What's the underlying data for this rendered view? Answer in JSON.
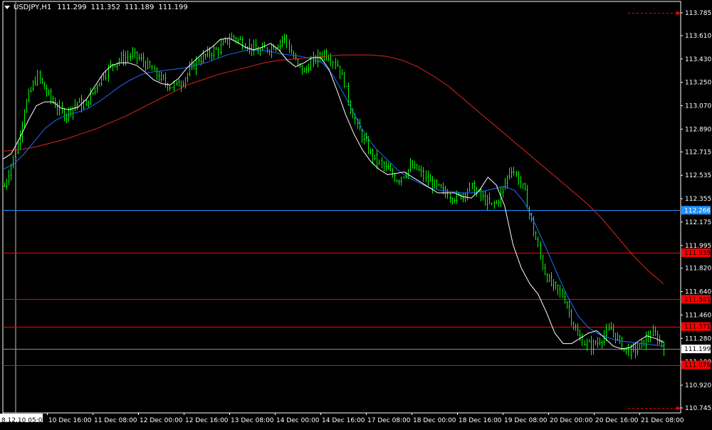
{
  "header": {
    "symbol": "USDJPY,H1",
    "open": "111.299",
    "high": "111.352",
    "low": "111.189",
    "close": "111.199"
  },
  "colors": {
    "background": "#000000",
    "axis": "#ffffff",
    "up_candle": "#00ff00",
    "down_candle": "#00ff00",
    "ma_fast": "#ffffff",
    "ma_mid": "#1e6fff",
    "ma_slow": "#e0241e",
    "support_line": "#1e90ff",
    "resistance_line": "#ff0000",
    "price_tag": "#ffffff"
  },
  "chart_data": {
    "type": "candlestick",
    "timeframe": "H1",
    "ylim": [
      110.745,
      113.785
    ],
    "y_ticks": [
      "113.785",
      "113.610",
      "113.430",
      "113.250",
      "113.070",
      "112.890",
      "112.715",
      "112.535",
      "112.355",
      "112.175",
      "111.995",
      "111.820",
      "111.640",
      "111.460",
      "111.280",
      "111.100",
      "110.920",
      "110.745"
    ],
    "x_ticks": [
      "8.12.10 05:00",
      "10 Dec 16:00",
      "11 Dec 08:00",
      "12 Dec 00:00",
      "12 Dec 16:00",
      "13 Dec 08:00",
      "14 Dec 00:00",
      "14 Dec 16:00",
      "17 Dec 08:00",
      "18 Dec 00:00",
      "18 Dec 16:00",
      "19 Dec 08:00",
      "20 Dec 00:00",
      "20 Dec 16:00",
      "21 Dec 08:00"
    ],
    "close_path": [
      112.45,
      112.62,
      112.78,
      113.05,
      113.2,
      113.3,
      113.2,
      113.12,
      113.05,
      113.0,
      113.05,
      113.1,
      113.06,
      113.15,
      113.25,
      113.32,
      113.38,
      113.42,
      113.44,
      113.46,
      113.44,
      113.4,
      113.35,
      113.3,
      113.25,
      113.22,
      113.23,
      113.28,
      113.35,
      113.42,
      113.45,
      113.48,
      113.5,
      113.55,
      113.6,
      113.58,
      113.55,
      113.52,
      113.48,
      113.5,
      113.52,
      113.55,
      113.6,
      113.48,
      113.38,
      113.33,
      113.4,
      113.44,
      113.48,
      113.44,
      113.38,
      113.25,
      113.05,
      112.9,
      112.8,
      112.7,
      112.64,
      112.6,
      112.55,
      112.5,
      112.55,
      112.6,
      112.58,
      112.52,
      112.48,
      112.44,
      112.4,
      112.38,
      112.36,
      112.4,
      112.45,
      112.4,
      112.35,
      112.3,
      112.33,
      112.45,
      112.6,
      112.52,
      112.42,
      112.2,
      112.0,
      111.8,
      111.7,
      111.65,
      111.6,
      111.45,
      111.3,
      111.25,
      111.22,
      111.25,
      111.3,
      111.35,
      111.28,
      111.2,
      111.18,
      111.2,
      111.25,
      111.32,
      111.28,
      111.22
    ],
    "ma_fast": [
      112.66,
      112.7,
      112.82,
      112.95,
      113.07,
      113.1,
      113.1,
      113.05,
      113.04,
      113.06,
      113.12,
      113.22,
      113.32,
      113.38,
      113.4,
      113.4,
      113.38,
      113.33,
      113.27,
      113.24,
      113.23,
      113.28,
      113.36,
      113.42,
      113.48,
      113.52,
      113.58,
      113.59,
      113.56,
      113.52,
      113.5,
      113.52,
      113.55,
      113.5,
      113.42,
      113.37,
      113.4,
      113.44,
      113.44,
      113.35,
      113.18,
      113.0,
      112.85,
      112.73,
      112.64,
      112.58,
      112.54,
      112.55,
      112.56,
      112.52,
      112.48,
      112.44,
      112.4,
      112.4,
      112.4,
      112.37,
      112.36,
      112.42,
      112.52,
      112.46,
      112.3,
      112.0,
      111.82,
      111.7,
      111.62,
      111.48,
      111.32,
      111.24,
      111.24,
      111.28,
      111.32,
      111.34,
      111.28,
      111.22,
      111.2,
      111.21,
      111.26,
      111.3,
      111.28,
      111.25
    ],
    "ma_mid": [
      112.58,
      112.62,
      112.7,
      112.8,
      112.9,
      112.96,
      113.0,
      113.02,
      113.05,
      113.1,
      113.16,
      113.22,
      113.27,
      113.31,
      113.33,
      113.34,
      113.35,
      113.36,
      113.38,
      113.4,
      113.43,
      113.46,
      113.48,
      113.5,
      113.5,
      113.49,
      113.47,
      113.46,
      113.45,
      113.43,
      113.4,
      113.3,
      113.16,
      113.0,
      112.85,
      112.74,
      112.66,
      112.58,
      112.52,
      112.48,
      112.44,
      112.42,
      112.41,
      112.4,
      112.4,
      112.41,
      112.43,
      112.45,
      112.42,
      112.32,
      112.15,
      111.97,
      111.78,
      111.6,
      111.45,
      111.36,
      111.31,
      111.28,
      111.26,
      111.25,
      111.24,
      111.23,
      111.22
    ],
    "ma_slow": [
      112.72,
      112.73,
      112.75,
      112.78,
      112.81,
      112.85,
      112.89,
      112.94,
      112.99,
      113.05,
      113.11,
      113.17,
      113.23,
      113.27,
      113.31,
      113.34,
      113.37,
      113.4,
      113.42,
      113.43,
      113.44,
      113.45,
      113.46,
      113.46,
      113.46,
      113.45,
      113.42,
      113.37,
      113.3,
      113.22,
      113.12,
      113.02,
      112.92,
      112.82,
      112.72,
      112.62,
      112.52,
      112.42,
      112.32,
      112.2,
      112.06,
      111.92,
      111.8,
      111.7
    ],
    "horizontal_levels": [
      {
        "price": 112.266,
        "label": "112.266",
        "kind": "support"
      },
      {
        "price": 111.939,
        "label": "111.939",
        "kind": "resistance"
      },
      {
        "price": 111.581,
        "label": "111.581",
        "kind": "resistance"
      },
      {
        "price": 111.371,
        "label": "111.371",
        "kind": "resistance"
      },
      {
        "price": 111.076,
        "label": "111.076",
        "kind": "resistance"
      }
    ],
    "current_price": {
      "price": 111.199,
      "label": "111.199"
    },
    "projection_levels": [
      113.785,
      110.745
    ]
  }
}
